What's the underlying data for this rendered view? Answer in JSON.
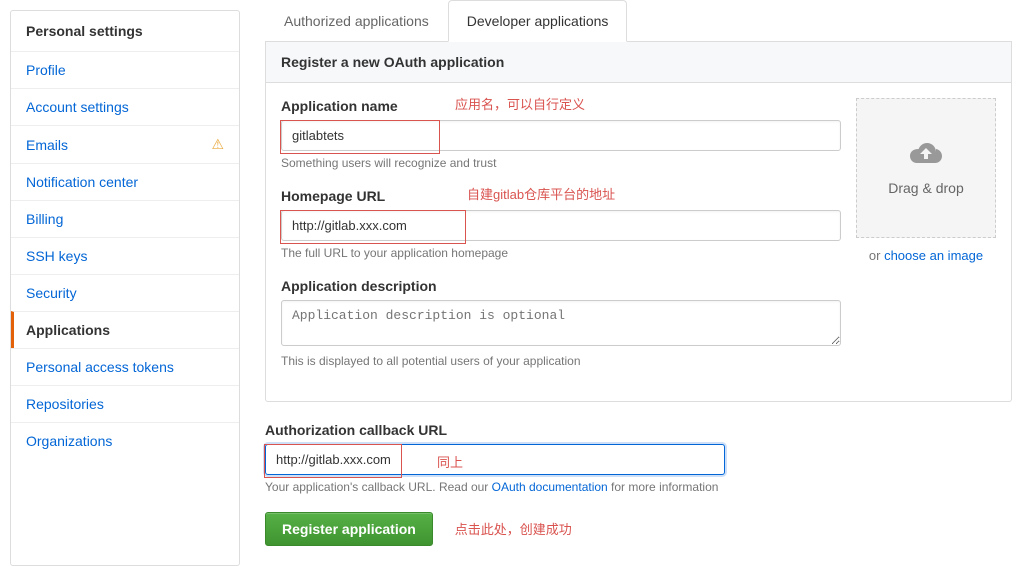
{
  "sidebar": {
    "header": "Personal settings",
    "items": [
      {
        "label": "Profile",
        "warning": false
      },
      {
        "label": "Account settings",
        "warning": false
      },
      {
        "label": "Emails",
        "warning": true
      },
      {
        "label": "Notification center",
        "warning": false
      },
      {
        "label": "Billing",
        "warning": false
      },
      {
        "label": "SSH keys",
        "warning": false
      },
      {
        "label": "Security",
        "warning": false
      },
      {
        "label": "Applications",
        "warning": false,
        "active": true
      },
      {
        "label": "Personal access tokens",
        "warning": false
      },
      {
        "label": "Repositories",
        "warning": false
      },
      {
        "label": "Organizations",
        "warning": false
      }
    ]
  },
  "tabs": {
    "authorized": "Authorized applications",
    "developer": "Developer applications"
  },
  "form": {
    "header": "Register a new OAuth application",
    "appname": {
      "label": "Application name",
      "value": "gitlabtets",
      "hint": "Something users will recognize and trust",
      "note": "应用名，可以自行定义"
    },
    "homepage": {
      "label": "Homepage URL",
      "value": "http://gitlab.xxx.com",
      "hint": "The full URL to your application homepage",
      "note": "自建gitlab仓库平台的地址"
    },
    "description": {
      "label": "Application description",
      "placeholder": "Application description is optional",
      "hint": "This is displayed to all potential users of your application"
    },
    "callback": {
      "label": "Authorization callback URL",
      "value": "http://gitlab.xxx.com",
      "hint_pre": "Your application's callback URL. Read our ",
      "hint_link": "OAuth documentation",
      "hint_post": " for more information",
      "note": "同上"
    },
    "upload": {
      "drop": "Drag & drop",
      "choose_pre": "or ",
      "choose_link": "choose an image"
    },
    "submit": {
      "label": "Register application",
      "note": "点击此处，创建成功"
    }
  }
}
